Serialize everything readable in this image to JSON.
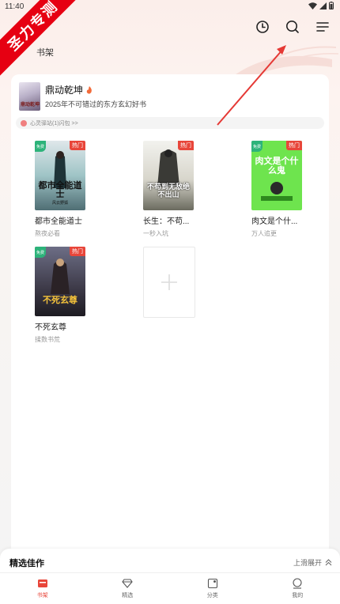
{
  "status": {
    "time": "11:40"
  },
  "watermark": {
    "text": "圣力专测"
  },
  "header": {
    "title": "书架"
  },
  "featured": {
    "title": "鼎动乾坤",
    "subtitle": "2025年不可错过的东方玄幻好书",
    "cover_brand": "鼎动乾坤"
  },
  "notice": {
    "text": "心灵驿站(1)闪包 >>"
  },
  "badges": {
    "free": "免费",
    "hot": "热门"
  },
  "books": [
    {
      "title": "都市全能道士",
      "subtitle": "熬夜必看",
      "cover_text": "都市全能道士",
      "cover_author": "风云野狐"
    },
    {
      "title": "长生：不苟...",
      "subtitle": "一秒入坑",
      "cover_text": "不苟到无敌绝不出山",
      "cover_author": ""
    },
    {
      "title": "肉文是个什...",
      "subtitle": "万人追更",
      "cover_text": "肉文是个什么鬼",
      "cover_author": ""
    },
    {
      "title": "不死玄尊",
      "subtitle": "揉数书荒",
      "cover_text": "不死玄尊",
      "cover_author": ""
    }
  ],
  "bottom_panel": {
    "title": "精选佳作",
    "expand_label": "上滑展开"
  },
  "tabs": [
    {
      "label": "书架",
      "icon": "bookshelf-icon",
      "active": true
    },
    {
      "label": "精选",
      "icon": "diamond-icon",
      "active": false
    },
    {
      "label": "分类",
      "icon": "category-icon",
      "active": false
    },
    {
      "label": "我的",
      "icon": "profile-icon",
      "active": false
    }
  ],
  "colors": {
    "accent": "#e8463a",
    "ribbon": "#e60012",
    "free_badge": "#2db37a"
  }
}
